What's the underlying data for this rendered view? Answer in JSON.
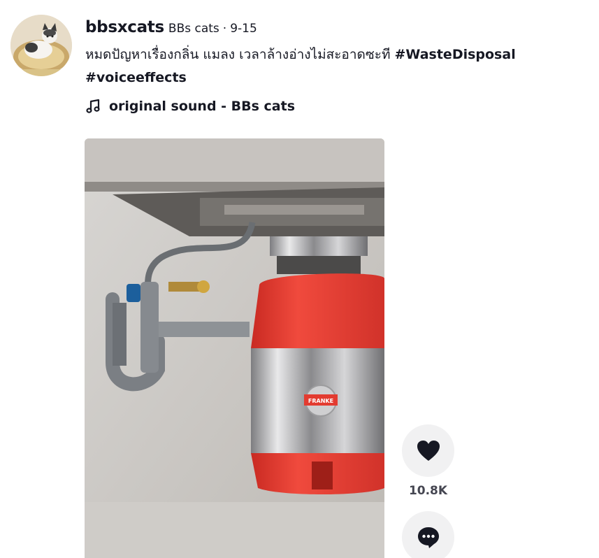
{
  "post": {
    "username": "bbsxcats",
    "nickname": "BBs cats",
    "separator": "·",
    "date": "9-15",
    "caption_text": "หมดปัญหาเรื่องกลิ่น แมลง เวลาล้างอ่างไม่สะอาดซะที ",
    "hashtags": [
      "#WasteDisposal",
      "#voiceeffects"
    ],
    "music": "original sound - BBs cats"
  },
  "video": {
    "brand_text": "FRANKE"
  },
  "actions": {
    "like_count": "10.8K"
  },
  "colors": {
    "text": "#161823",
    "action_bg": "#f1f1f2",
    "disposer_red": "#e8392f"
  }
}
